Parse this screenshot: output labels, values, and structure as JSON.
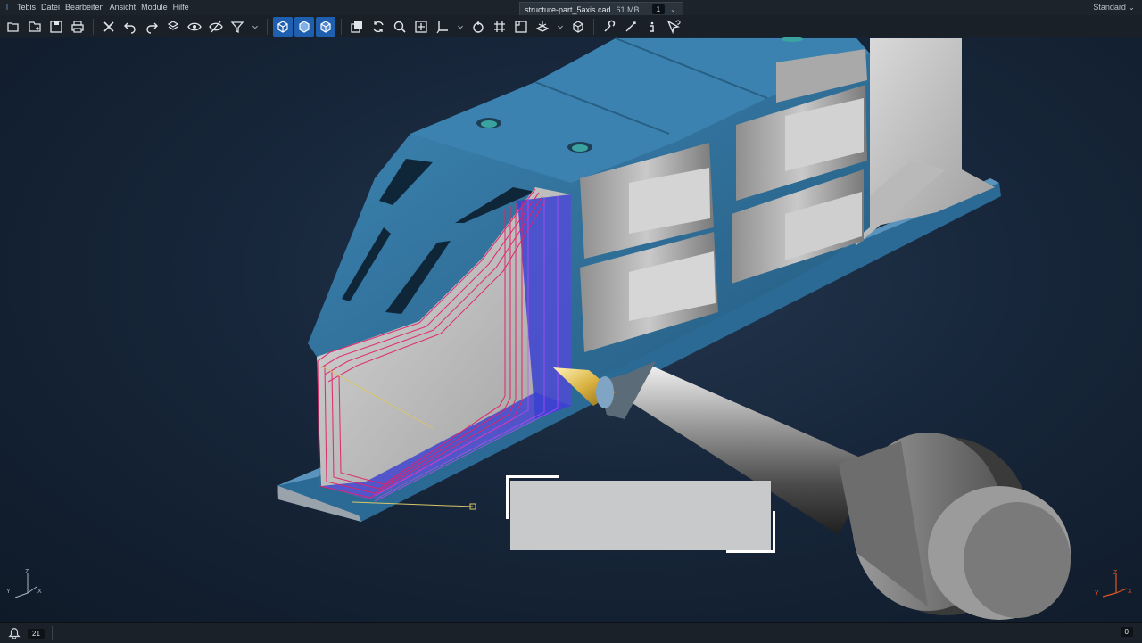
{
  "app": {
    "logo_glyph": "⊤"
  },
  "menu": {
    "items": [
      "Tebis",
      "Datei",
      "Bearbeiten",
      "Ansicht",
      "Module",
      "Hilfe"
    ]
  },
  "document_tab": {
    "filename": "structure-part_5axis.cad",
    "size": "61 MB",
    "window_count": "1"
  },
  "layout": {
    "label": "Standard",
    "chevron": "⌄"
  },
  "toolbar": {
    "groups": [
      [
        "open-file-icon",
        "new-folder-icon",
        "save-icon",
        "print-icon"
      ],
      [
        "delete-icon",
        "undo-icon",
        "redo-icon",
        "layer-icon",
        "show-icon",
        "hide-icon",
        "filter-icon"
      ],
      [
        "wireframe-view-icon",
        "shaded-view-icon",
        "shaded-edges-view-icon"
      ],
      [
        "layers-icon",
        "refresh-icon",
        "zoom-icon",
        "zoom-fit-icon",
        "axis-icon",
        "rotate-icon",
        "grid-icon",
        "frame-icon",
        "view-icon",
        "box-view-icon"
      ],
      [
        "tools-icon",
        "measure-icon",
        "info-icon",
        "help-cursor-icon"
      ]
    ],
    "active": [
      "wireframe-view-icon",
      "shaded-view-icon",
      "shaded-edges-view-icon"
    ]
  },
  "triad": {
    "z": "Z",
    "y": "Y",
    "x": "X"
  },
  "status": {
    "messages_count": "21",
    "right_count": "0"
  },
  "colors": {
    "part_blue": "#2f6f99",
    "toolpath_magenta": "#e0246a",
    "toolpath_blue": "#3a3fd0",
    "active_button": "#1f5fb0"
  }
}
